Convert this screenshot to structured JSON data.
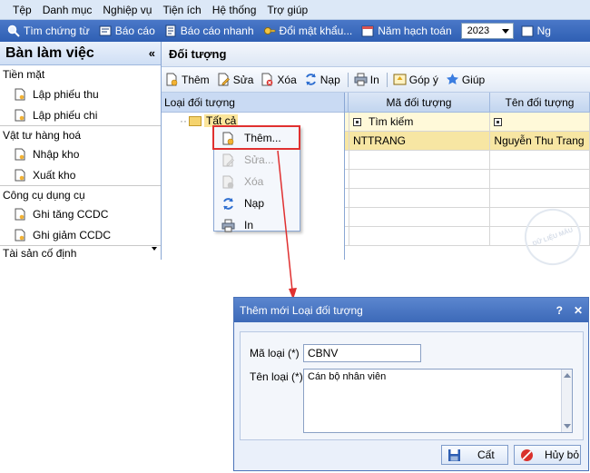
{
  "menubar": {
    "items": [
      "Tệp",
      "Danh mục",
      "Nghiệp vụ",
      "Tiện ích",
      "Hệ thống",
      "Trợ giúp"
    ]
  },
  "toolbar": {
    "items": [
      {
        "label": "Tìm chứng từ",
        "icon": "search-icon"
      },
      {
        "label": "Báo cáo",
        "icon": "report-icon"
      },
      {
        "label": "Báo cáo nhanh",
        "icon": "quick-report-icon"
      },
      {
        "label": "Đổi mật khẩu...",
        "icon": "key-icon"
      },
      {
        "label": "Năm hạch toán",
        "icon": "calendar-icon"
      }
    ],
    "year": "2023",
    "trailing_label": "Ng"
  },
  "left_panel": {
    "title": "Bàn làm việc",
    "collapse": "«",
    "groups": [
      {
        "label": "Tiền mặt",
        "items": [
          "Lập phiếu thu",
          "Lập phiếu chi"
        ]
      },
      {
        "label": "Vật tư hàng hoá",
        "items": [
          "Nhập kho",
          "Xuất kho"
        ]
      },
      {
        "label": "Công cụ dụng cụ",
        "items": [
          "Ghi tăng CCDC",
          "Ghi giảm CCDC"
        ]
      },
      {
        "label": "Tài sản cố định",
        "items": []
      }
    ]
  },
  "right_panel": {
    "title": "Đối tượng",
    "actions": [
      {
        "label": "Thêm",
        "icon": "add-doc-icon"
      },
      {
        "label": "Sửa",
        "icon": "edit-icon"
      },
      {
        "label": "Xóa",
        "icon": "delete-icon"
      },
      {
        "label": "Nạp",
        "icon": "refresh-icon"
      },
      {
        "label": "In",
        "icon": "printer-icon"
      },
      {
        "label": "Góp ý",
        "icon": "feedback-icon"
      },
      {
        "label": "Giúp",
        "icon": "help-icon"
      }
    ],
    "tree": {
      "header": "Loại đối tượng",
      "root": "Tất cả"
    },
    "grid": {
      "columns": [
        "Mã đối tượng",
        "Tên đối tượng"
      ],
      "filter_placeholder": "Tìm kiếm",
      "rows": [
        {
          "code": "NTTRANG",
          "name": "Nguyễn Thu Trang"
        }
      ]
    }
  },
  "context_menu": {
    "items": [
      {
        "label": "Thêm...",
        "enabled": true,
        "icon": "add-doc-icon"
      },
      {
        "label": "Sửa...",
        "enabled": false,
        "icon": "edit-icon"
      },
      {
        "label": "Xóa",
        "enabled": false,
        "icon": "delete-icon"
      },
      {
        "label": "Nạp",
        "enabled": true,
        "icon": "refresh-icon"
      },
      {
        "label": "In",
        "enabled": true,
        "icon": "printer-icon"
      }
    ]
  },
  "watermark": {
    "text": "DỮ LIỆU MẪU"
  },
  "dialog": {
    "title": "Thêm mới Loại đối tượng",
    "help": "?",
    "close": "✕",
    "code_label": "Mã loại (*)",
    "code_value": "CBNV",
    "name_label": "Tên loại (*)",
    "name_value": "Cán bộ nhân viên",
    "save_label": "Cất",
    "cancel_label": "Hủy bỏ"
  },
  "colors": {
    "accent": "#3c69b8",
    "highlight_border": "#e03030",
    "selected_row": "#f7e6a3"
  }
}
